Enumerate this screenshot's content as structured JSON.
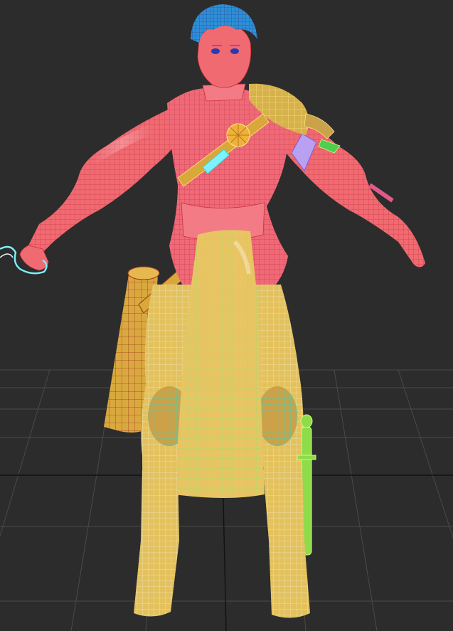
{
  "viewport": {
    "view": "perspective",
    "shading": "shaded-with-wireframe",
    "background_color": "#2c2c2c",
    "grid_color": "#4a4a4a",
    "grid_axis_color": "#111111"
  },
  "model": {
    "subject": "character",
    "pose": "A-pose",
    "part_colors": {
      "hair": "#2f8fd6",
      "skin": "#f06a72",
      "shirt": "#ef6a78",
      "pants": "#e3c25e",
      "apron": "#e8c563",
      "scroll_case": "#d9a93f",
      "knee_pads": "#c9a24a",
      "shoulder_armor": "#d6b24d",
      "sword": "#8fdc4a",
      "armband": "#b9a0f0",
      "strap": "#d8a93a",
      "medallion": "#f0b13a"
    },
    "wire_colors": {
      "hair": "#1f3a8a",
      "shirt": "#c8323c",
      "pants": "#f4f0d4",
      "apron": "#8ee06f",
      "scroll_case": "#a0361e",
      "knee_pads": "#2ed8c8",
      "sword": "#c8ff7a",
      "armband": "#7d5cd6",
      "shoulder_armor": "#ffe07a",
      "wrist_wrap": "#7ff0ff"
    }
  }
}
